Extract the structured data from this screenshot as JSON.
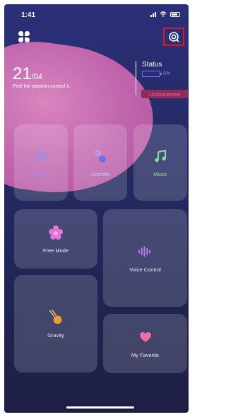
{
  "status_bar": {
    "time": "1:41"
  },
  "header": {
    "date_day": "21",
    "date_month": "/04",
    "tagline": "Feel the passion,control it."
  },
  "device_status": {
    "title": "Status",
    "battery_percent": "0%",
    "connection": "Unconnected"
  },
  "tiles": [
    {
      "label": "Pattern",
      "icon": "wave-icon"
    },
    {
      "label": "Remote",
      "icon": "remote-icon"
    },
    {
      "label": "Music",
      "icon": "music-note-icon"
    },
    {
      "label": "Free Mode",
      "icon": "flower-icon"
    },
    {
      "label": "Voice Control",
      "icon": "audio-waves-icon"
    },
    {
      "label": "Gravity",
      "icon": "gravity-ball-icon"
    },
    {
      "label": "My Favorite",
      "icon": "heart-icon"
    }
  ],
  "colors": {
    "accent_red": "#e0152a",
    "pink_blob": "#c766b0",
    "unconnected_text": "#ff5c86",
    "background_top": "#2b2f78"
  }
}
